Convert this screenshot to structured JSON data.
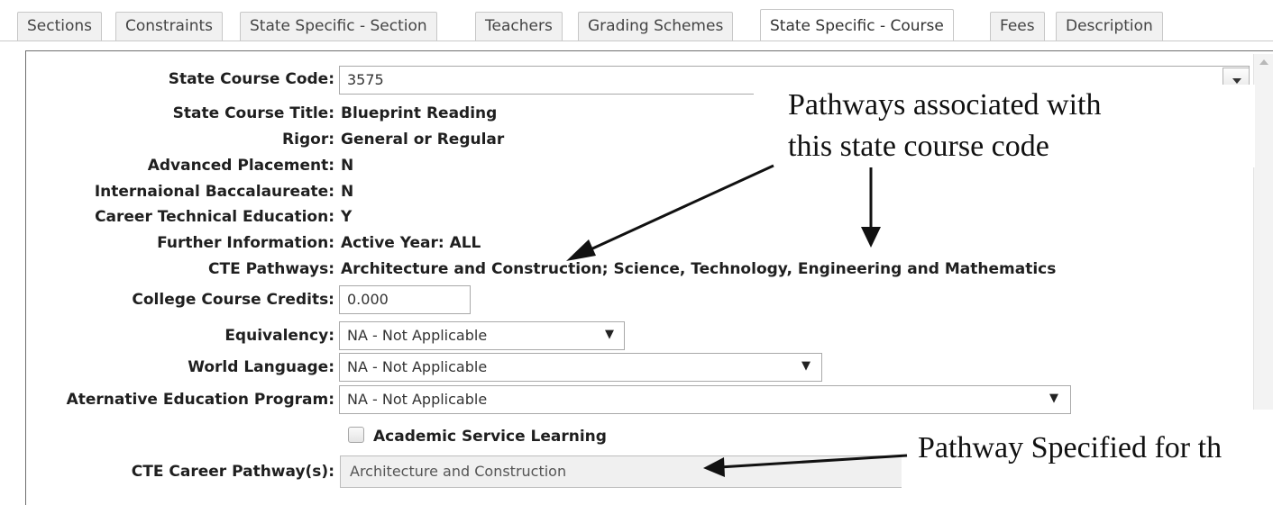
{
  "tabs": [
    {
      "label": "Sections",
      "active": false
    },
    {
      "label": "Constraints",
      "active": false
    },
    {
      "label": "State Specific - Section",
      "active": false
    },
    {
      "label": "Teachers",
      "active": false
    },
    {
      "label": "Grading Schemes",
      "active": false
    },
    {
      "label": "State Specific - Course",
      "active": true
    },
    {
      "label": "Fees",
      "active": false
    },
    {
      "label": "Description",
      "active": false
    }
  ],
  "form": {
    "state_course_code": {
      "label": "State Course Code:",
      "value": "3575"
    },
    "state_course_title": {
      "label": "State Course Title:",
      "value": "Blueprint Reading"
    },
    "rigor": {
      "label": "Rigor:",
      "value": "General or Regular"
    },
    "advanced_placement": {
      "label": "Advanced Placement:",
      "value": "N"
    },
    "intl_baccalaureate": {
      "label": "Internaional Baccalaureate:",
      "value": "N"
    },
    "career_technical_education": {
      "label": "Career Technical Education:",
      "value": "Y"
    },
    "further_information": {
      "label": "Further Information:",
      "value": "Active Year: ALL"
    },
    "cte_pathways": {
      "label": "CTE Pathways:",
      "value": "Architecture and Construction; Science, Technology, Engineering and Mathematics"
    },
    "college_course_credits": {
      "label": "College Course Credits:",
      "value": "0.000"
    },
    "equivalency": {
      "label": "Equivalency:",
      "value": "NA - Not Applicable"
    },
    "world_language": {
      "label": "World Language:",
      "value": "NA - Not Applicable"
    },
    "alternative_education_program": {
      "label": "Aternative Education Program:",
      "value": "NA - Not Applicable"
    },
    "academic_service_learning": {
      "label": "Academic Service Learning",
      "checked": false
    },
    "cte_career_pathways": {
      "label": "CTE Career Pathway(s):",
      "value": "Architecture and Construction"
    }
  },
  "annotations": {
    "pathways_note_line1": "Pathways associated with",
    "pathways_note_line2": "this state course code",
    "specified_note": "Pathway Specified for th"
  },
  "icons": {
    "select_arrow": "▼",
    "combo_arrow": "chevron-down-icon",
    "scroll_up": "scroll-up-icon"
  }
}
